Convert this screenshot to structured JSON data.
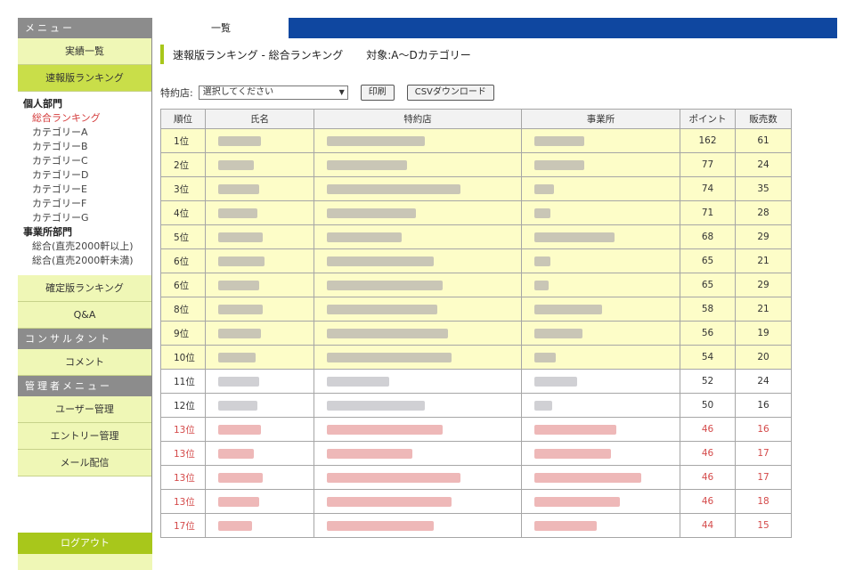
{
  "sidebar": {
    "menu_header": "メニュー",
    "btn_results": "実績一覧",
    "btn_prelim": "速報版ランキング",
    "categories": {
      "head_individual": "個人部門",
      "individual_items": [
        "総合ランキング",
        "カテゴリーA",
        "カテゴリーB",
        "カテゴリーC",
        "カテゴリーD",
        "カテゴリーE",
        "カテゴリーF",
        "カテゴリーG"
      ],
      "head_office": "事業所部門",
      "office_items": [
        "総合(直売2000軒以上)",
        "総合(直売2000軒未満)"
      ]
    },
    "btn_final": "確定版ランキング",
    "btn_qa": "Q&A",
    "consultant_header": "コンサルタント",
    "btn_comment": "コメント",
    "admin_header": "管理者メニュー",
    "btn_users": "ユーザー管理",
    "btn_entry": "エントリー管理",
    "btn_mail": "メール配信",
    "btn_logout": "ログアウト"
  },
  "topbar": {
    "tab_label": "一覧"
  },
  "main": {
    "title": "速報版ランキング - 総合ランキング",
    "target": "対象:A〜Dカテゴリー",
    "filter_label": "特約店:",
    "select_value": "選択してください",
    "print_label": "印刷",
    "csv_label": "CSVダウンロード",
    "headers": [
      "順位",
      "氏名",
      "特約店",
      "事業所",
      "ポイント",
      "販売数"
    ],
    "rows": [
      {
        "rank": "1位",
        "points": "162",
        "sales": "61"
      },
      {
        "rank": "2位",
        "points": "77",
        "sales": "24"
      },
      {
        "rank": "3位",
        "points": "74",
        "sales": "35"
      },
      {
        "rank": "4位",
        "points": "71",
        "sales": "28"
      },
      {
        "rank": "5位",
        "points": "68",
        "sales": "29"
      },
      {
        "rank": "6位",
        "points": "65",
        "sales": "21"
      },
      {
        "rank": "6位",
        "points": "65",
        "sales": "29"
      },
      {
        "rank": "8位",
        "points": "58",
        "sales": "21"
      },
      {
        "rank": "9位",
        "points": "56",
        "sales": "19"
      },
      {
        "rank": "10位",
        "points": "54",
        "sales": "20"
      },
      {
        "rank": "11位",
        "points": "52",
        "sales": "24"
      },
      {
        "rank": "12位",
        "points": "50",
        "sales": "16"
      },
      {
        "rank": "13位",
        "points": "46",
        "sales": "16"
      },
      {
        "rank": "13位",
        "points": "46",
        "sales": "17"
      },
      {
        "rank": "13位",
        "points": "46",
        "sales": "17"
      },
      {
        "rank": "13位",
        "points": "46",
        "sales": "18"
      },
      {
        "rank": "17位",
        "points": "44",
        "sales": "15"
      }
    ]
  },
  "colors": {
    "accent": "#a8c71b",
    "topbar": "#0f47a0",
    "highlight_row": "#fdfdc8",
    "red_text": "#d44a4a"
  }
}
